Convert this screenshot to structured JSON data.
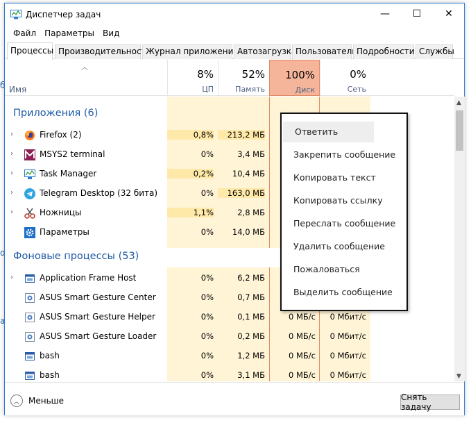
{
  "window": {
    "title": "Диспетчер задач",
    "controls": {
      "minimize": "—",
      "maximize": "☐",
      "close": "✕"
    }
  },
  "menu": [
    "Файл",
    "Параметры",
    "Вид"
  ],
  "tabs": [
    "Процессы",
    "Производительность",
    "Журнал приложений",
    "Автозагрузка",
    "Пользователи",
    "Подробности",
    "Службы"
  ],
  "active_tab": 0,
  "columns": {
    "name": "Имя",
    "cpu": {
      "pct": "8%",
      "label": "ЦП"
    },
    "mem": {
      "pct": "52%",
      "label": "Память"
    },
    "disk": {
      "pct": "100%",
      "label": "Диск"
    },
    "net": {
      "pct": "0%",
      "label": "Сеть"
    }
  },
  "groups": {
    "apps": "Приложения (6)",
    "background": "Фоновые процессы (53)"
  },
  "apps": [
    {
      "name": "Firefox (2)",
      "cpu": "0,8%",
      "mem": "213,2 МБ",
      "icon": "firefox-icon",
      "expand": true
    },
    {
      "name": "MSYS2 terminal",
      "cpu": "0%",
      "mem": "3,4 МБ",
      "icon": "msys2-icon",
      "expand": true
    },
    {
      "name": "Task Manager",
      "cpu": "0,2%",
      "mem": "10,4 МБ",
      "icon": "task-manager-icon",
      "expand": true
    },
    {
      "name": "Telegram Desktop (32 бита)",
      "cpu": "0%",
      "mem": "163,0 МБ",
      "icon": "telegram-icon",
      "expand": true
    },
    {
      "name": "Ножницы",
      "cpu": "1,1%",
      "mem": "2,8 МБ",
      "icon": "scissors-icon",
      "expand": true
    },
    {
      "name": "Параметры",
      "cpu": "0%",
      "mem": "14,0 МБ",
      "icon": "gear-icon",
      "expand": false
    }
  ],
  "background": [
    {
      "name": "Application Frame Host",
      "cpu": "0%",
      "mem": "6,2 МБ",
      "disk": "",
      "net": "",
      "icon": "window-icon",
      "expand": true
    },
    {
      "name": "ASUS Smart Gesture Center",
      "cpu": "0%",
      "mem": "0,7 МБ",
      "disk": "",
      "net": "",
      "icon": "gesture-icon",
      "expand": false
    },
    {
      "name": "ASUS Smart Gesture Helper",
      "cpu": "0%",
      "mem": "0,1 МБ",
      "disk": "0 МБ/с",
      "net": "0 Мбит/с",
      "icon": "gesture-icon",
      "expand": false
    },
    {
      "name": "ASUS Smart Gesture Loader",
      "cpu": "0%",
      "mem": "0,2 МБ",
      "disk": "0 МБ/с",
      "net": "0 Мбит/с",
      "icon": "gesture-icon",
      "expand": false
    },
    {
      "name": "bash",
      "cpu": "0%",
      "mem": "1,2 МБ",
      "disk": "0 МБ/с",
      "net": "0 Мбит/с",
      "icon": "window-icon",
      "expand": false
    },
    {
      "name": "bash",
      "cpu": "0%",
      "mem": "3,1 МБ",
      "disk": "0 МБ/с",
      "net": "0 Мбит/с",
      "icon": "window-icon",
      "expand": false
    }
  ],
  "footer": {
    "less": "Меньше",
    "end_task": "Снять задачу"
  },
  "context_menu": [
    "Ответить",
    "Закрепить сообщение",
    "Копировать текст",
    "Копировать ссылку",
    "Переслать сообщение",
    "Удалить сообщение",
    "Пожаловаться",
    "Выделить сообщение"
  ],
  "colors": {
    "accent": "#2b78d6",
    "heat_light": "#fff4d6",
    "heat_mid": "#ffe9a8",
    "disk_hot": "#f5b59b",
    "group_title": "#1f5aa6"
  }
}
